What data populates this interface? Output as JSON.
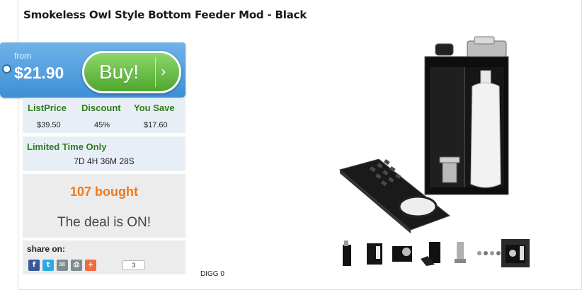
{
  "product": {
    "title": "Smokeless Owl Style Bottom Feeder Mod - Black"
  },
  "price_tag": {
    "from_label": "from",
    "price": "$21.90",
    "buy_label": "Buy!",
    "buy_arrow_icon": "chevron-right-icon"
  },
  "prices": {
    "headers": [
      "ListPrice",
      "Discount",
      "You Save"
    ],
    "values": [
      "$39.50",
      "45%",
      "$17.60"
    ]
  },
  "timer": {
    "label": "Limited Time Only",
    "value": "7D 4H 36M 28S"
  },
  "deal": {
    "bought": "107 bought",
    "status": "The deal is ON!"
  },
  "share": {
    "label": "share on:",
    "buttons": [
      {
        "icon": "facebook-icon",
        "glyph": "f",
        "color": "#3b5998"
      },
      {
        "icon": "twitter-icon",
        "glyph": "t",
        "color": "#2fa7df"
      },
      {
        "icon": "email-icon",
        "glyph": "✉",
        "color": "#7f8c8d"
      },
      {
        "icon": "print-icon",
        "glyph": "⎙",
        "color": "#7f8c8d"
      },
      {
        "icon": "plus-icon",
        "glyph": "+",
        "color": "#f26b3a"
      }
    ],
    "count": "3"
  },
  "digg": "DIGG 0",
  "thumbnails": {
    "count": 7,
    "active_index": 6
  },
  "colors": {
    "tag_blue": "#3d8fd6",
    "buy_green": "#4ea82e",
    "label_green": "#2e7d1e",
    "bought_orange": "#f07818",
    "panel_bg": "#e8eef5"
  }
}
